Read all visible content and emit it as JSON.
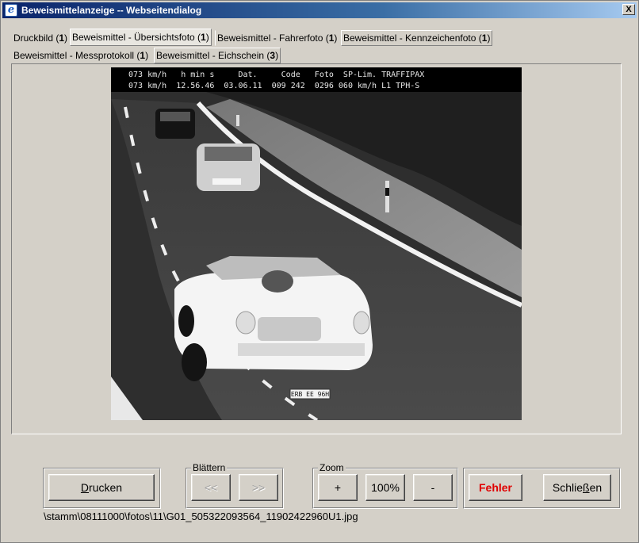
{
  "window": {
    "title": "Beweismittelanzeige -- Webseitendialog",
    "app_icon": "e",
    "close_glyph": "X"
  },
  "tabs": [
    {
      "label": "Druckbild (",
      "count": "1",
      "suffix": ")",
      "active": false
    },
    {
      "label": "Beweismittel - Übersichtsfoto (",
      "count": "1",
      "suffix": ")",
      "active": true
    },
    {
      "label": "Beweismittel - Fahrerfoto (",
      "count": "1",
      "suffix": ")",
      "active": false
    },
    {
      "label": "Beweismittel - Kennzeichenfoto (",
      "count": "1",
      "suffix": ")",
      "active": false
    },
    {
      "label": "Beweismittel - Messprotokoll (",
      "count": "1",
      "suffix": ")",
      "active": false
    },
    {
      "label": "Beweismittel - Eichschein (",
      "count": "3",
      "suffix": ")",
      "active": false
    }
  ],
  "photo": {
    "header_line": "073 km/h   h min s     Dat.     Code   Foto  SP-Lim. TRAFFIPAX",
    "data_line": "073 km/h  12.56.46  03.06.11  009 242  0296 060 km/h L1 TPH-S",
    "plate_text": "ERB EE 96H"
  },
  "toolbar": {
    "print_label_pre": "",
    "print_label_u": "D",
    "print_label_post": "rucken",
    "browse_group": "Blättern",
    "prev_label": "<<",
    "next_label": ">>",
    "zoom_group": "Zoom",
    "zoom_in_label": "+",
    "zoom_reset_label": "100%",
    "zoom_out_label": "-",
    "error_label": "Fehler",
    "close_label_pre": "Schlie",
    "close_label_u": "ß",
    "close_label_post": "en"
  },
  "file_path": "\\stamm\\08111000\\fotos\\11\\G01_505322093564_11902422960U1.jpg",
  "colors": {
    "title_gradient_start": "#0a246a",
    "title_gradient_end": "#a6caf0",
    "dialog_bg": "#d4d0c8",
    "error_text": "#e00000"
  }
}
